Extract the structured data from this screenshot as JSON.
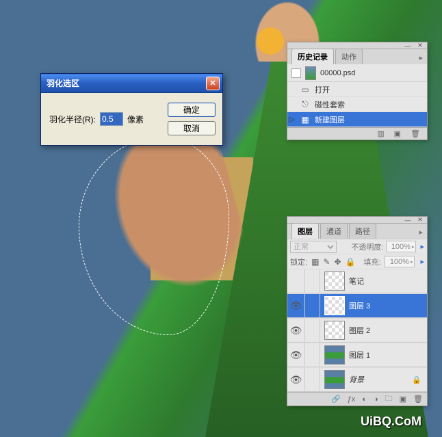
{
  "canvas": {
    "selection_shape": "lasso",
    "watermark": "UiBQ.CoM"
  },
  "feather_dialog": {
    "title": "羽化选区",
    "radius_label": "羽化半径(R):",
    "radius_value": "0.5",
    "unit_label": "像素",
    "ok_label": "确定",
    "cancel_label": "取消"
  },
  "history_panel": {
    "tabs": [
      {
        "label": "历史记录",
        "active": true
      },
      {
        "label": "动作",
        "active": false
      }
    ],
    "source_doc": "00000.psd",
    "items": [
      {
        "icon": "open-icon",
        "label": "打开",
        "selected": false
      },
      {
        "icon": "magnetic-lasso-icon",
        "label": "磁性套索",
        "selected": false
      },
      {
        "icon": "new-layer-icon",
        "label": "新建图层",
        "selected": true
      }
    ]
  },
  "layers_panel": {
    "tabs": [
      {
        "label": "图层",
        "active": true
      },
      {
        "label": "通道",
        "active": false
      },
      {
        "label": "路径",
        "active": false
      }
    ],
    "blend_mode": "正常",
    "opacity_label": "不透明度:",
    "opacity_value": "100%",
    "lock_label": "锁定:",
    "fill_label": "填充:",
    "fill_value": "100%",
    "layers": [
      {
        "name": "笔记",
        "visible": false,
        "selected": false,
        "locked": false,
        "thumb": "checker"
      },
      {
        "name": "图层 3",
        "visible": true,
        "selected": true,
        "locked": false,
        "thumb": "checker"
      },
      {
        "name": "图层 2",
        "visible": true,
        "selected": false,
        "locked": false,
        "thumb": "checker"
      },
      {
        "name": "图层 1",
        "visible": true,
        "selected": false,
        "locked": false,
        "thumb": "model"
      },
      {
        "name": "背景",
        "visible": true,
        "selected": false,
        "locked": true,
        "thumb": "model"
      }
    ]
  }
}
